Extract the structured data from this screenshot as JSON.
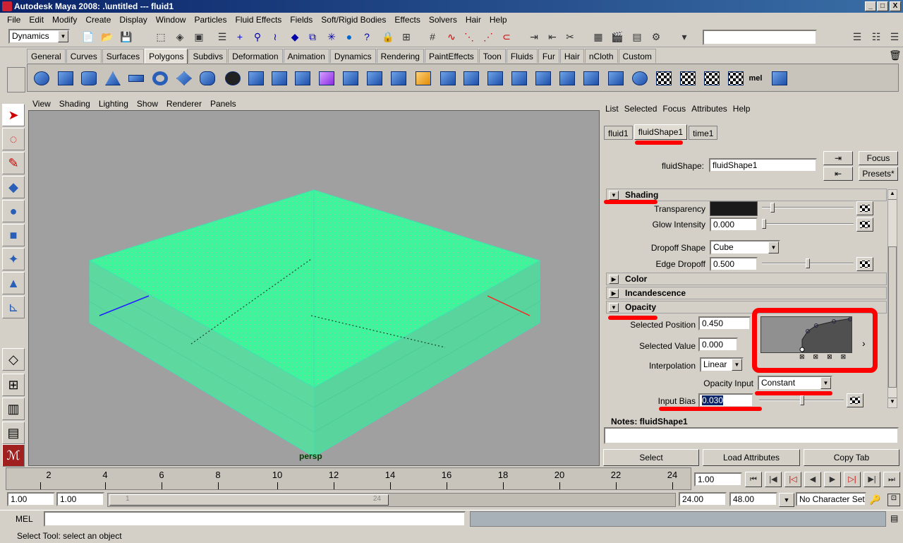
{
  "window": {
    "title": "Autodesk Maya 2008: .\\untitled   ---   fluid1",
    "min": "_",
    "max": "□",
    "close": "X"
  },
  "menubar": [
    "File",
    "Edit",
    "Modify",
    "Create",
    "Display",
    "Window",
    "Particles",
    "Fluid Effects",
    "Fields",
    "Soft/Rigid Bodies",
    "Effects",
    "Solvers",
    "Hair",
    "Help"
  ],
  "statusline": {
    "menuset": "Dynamics",
    "arrow": "▼",
    "input_value": ""
  },
  "shelf": {
    "tabs": [
      "General",
      "Curves",
      "Surfaces",
      "Polygons",
      "Subdivs",
      "Deformation",
      "Animation",
      "Dynamics",
      "Rendering",
      "PaintEffects",
      "Toon",
      "Fluids",
      "Fur",
      "Hair",
      "nCloth",
      "Custom"
    ],
    "active": "Polygons",
    "mel_label": "mel"
  },
  "viewport": {
    "menu": [
      "View",
      "Shading",
      "Lighting",
      "Show",
      "Renderer",
      "Panels"
    ],
    "camera": "persp"
  },
  "attr_editor": {
    "menu": [
      "List",
      "Selected",
      "Focus",
      "Attributes",
      "Help"
    ],
    "tabs": [
      "fluid1",
      "fluidShape1",
      "time1"
    ],
    "active_tab": "fluidShape1",
    "node_label": "fluidShape:",
    "node_value": "fluidShape1",
    "focus_btn": "Focus",
    "presets_btn": "Presets*",
    "sections": {
      "shading": "Shading",
      "color": "Color",
      "incandescence": "Incandescence",
      "opacity": "Opacity"
    },
    "shading": {
      "transparency_label": "Transparency",
      "transparency_color": "#1a1a1a",
      "glow_label": "Glow Intensity",
      "glow_value": "0.000",
      "dropoff_label": "Dropoff Shape",
      "dropoff_value": "Cube",
      "edge_label": "Edge Dropoff",
      "edge_value": "0.500"
    },
    "opacity": {
      "selpos_label": "Selected Position",
      "selpos_value": "0.450",
      "selval_label": "Selected Value",
      "selval_value": "0.000",
      "interp_label": "Interpolation",
      "interp_value": "Linear",
      "input_label": "Opacity Input",
      "input_value": "Constant",
      "bias_label": "Input Bias",
      "bias_value": "0.030",
      "expand": "›"
    },
    "notes_label": "Notes:  fluidShape1",
    "buttons": {
      "select": "Select",
      "load": "Load Attributes",
      "copy": "Copy Tab"
    }
  },
  "timeline": {
    "ticks": [
      "2",
      "4",
      "6",
      "8",
      "10",
      "12",
      "14",
      "16",
      "18",
      "20",
      "22",
      "24"
    ],
    "current": "1.00"
  },
  "range": {
    "start": "1.00",
    "start2": "1.00",
    "slider_start": "1",
    "slider_end": "24",
    "end": "24.00",
    "end2": "48.00",
    "char_set": "No Character Set"
  },
  "cmdline": {
    "label": "MEL",
    "value": ""
  },
  "helpline": "Select Tool: select an object",
  "colors": {
    "fluid": "#3ff59b",
    "bbox": "#40e0b0",
    "highlight": "#ff0000"
  }
}
